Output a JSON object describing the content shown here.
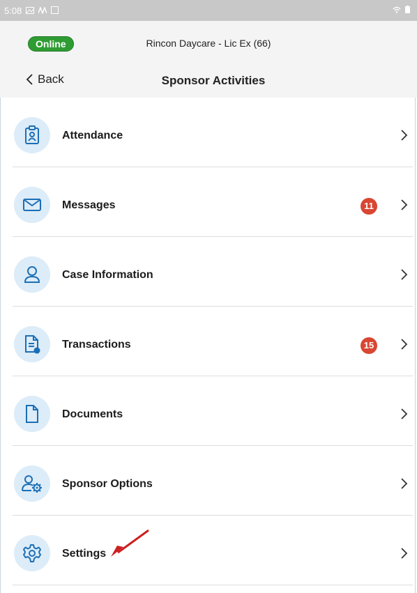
{
  "status_bar": {
    "time": "5:08"
  },
  "header": {
    "connection_status": "Online",
    "location": "Rincon Daycare - Lic Ex (66)",
    "back_label": "Back",
    "title": "Sponsor Activities"
  },
  "menu": {
    "items": [
      {
        "label": "Attendance",
        "icon": "attendance-badge-icon",
        "badge": ""
      },
      {
        "label": "Messages",
        "icon": "envelope-icon",
        "badge": "11"
      },
      {
        "label": "Case Information",
        "icon": "person-icon",
        "badge": ""
      },
      {
        "label": "Transactions",
        "icon": "document-clock-icon",
        "badge": "15"
      },
      {
        "label": "Documents",
        "icon": "document-icon",
        "badge": ""
      },
      {
        "label": "Sponsor Options",
        "icon": "person-gear-icon",
        "badge": ""
      },
      {
        "label": "Settings",
        "icon": "gear-icon",
        "badge": ""
      }
    ]
  },
  "colors": {
    "online": "#2f9c33",
    "badge": "#d94632",
    "icon_circle": "#dcecf8",
    "icon_stroke": "#1c6fb5",
    "annotation_arrow": "#cc1f1f"
  }
}
